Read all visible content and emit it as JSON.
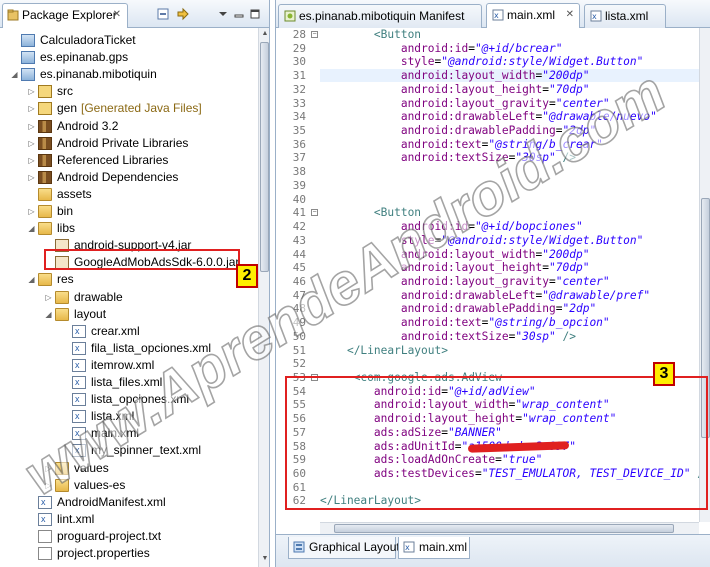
{
  "package_explorer": {
    "tab_label": "Package Explorer",
    "tree": [
      {
        "label": "CalculadoraTicket",
        "icon": "android-project-icon",
        "depth": 0,
        "twisty": ""
      },
      {
        "label": "es.epinanab.gps",
        "icon": "android-project-icon",
        "depth": 0,
        "twisty": ""
      },
      {
        "label": "es.pinanab.mibotiquin",
        "icon": "android-project-icon",
        "depth": 0,
        "twisty": "open"
      },
      {
        "label": "src",
        "icon": "source-folder-icon",
        "depth": 1,
        "twisty": "closed"
      },
      {
        "label": "gen",
        "note": "[Generated Java Files]",
        "icon": "source-folder-icon",
        "depth": 1,
        "twisty": "closed"
      },
      {
        "label": "Android 3.2",
        "icon": "library-icon",
        "depth": 1,
        "twisty": "closed"
      },
      {
        "label": "Android Private Libraries",
        "icon": "library-icon",
        "depth": 1,
        "twisty": "closed"
      },
      {
        "label": "Referenced Libraries",
        "icon": "library-icon",
        "depth": 1,
        "twisty": "closed"
      },
      {
        "label": "Android Dependencies",
        "icon": "library-icon",
        "depth": 1,
        "twisty": "closed"
      },
      {
        "label": "assets",
        "icon": "folder-icon",
        "depth": 1,
        "twisty": ""
      },
      {
        "label": "bin",
        "icon": "folder-icon",
        "depth": 1,
        "twisty": "closed"
      },
      {
        "label": "libs",
        "icon": "folder-icon",
        "depth": 1,
        "twisty": "open"
      },
      {
        "label": "android-support-v4.jar",
        "icon": "jar-icon",
        "depth": 2,
        "twisty": ""
      },
      {
        "label": "GoogleAdMobAdsSdk-6.0.0.jar",
        "icon": "jar-icon",
        "depth": 2,
        "twisty": ""
      },
      {
        "label": "res",
        "icon": "folder-icon",
        "depth": 1,
        "twisty": "open"
      },
      {
        "label": "drawable",
        "icon": "folder-icon",
        "depth": 2,
        "twisty": "closed"
      },
      {
        "label": "layout",
        "icon": "folder-icon",
        "depth": 2,
        "twisty": "open"
      },
      {
        "label": "crear.xml",
        "icon": "xml-file-icon",
        "depth": 3,
        "twisty": ""
      },
      {
        "label": "fila_lista_opciones.xml",
        "icon": "xml-file-icon",
        "depth": 3,
        "twisty": ""
      },
      {
        "label": "itemrow.xml",
        "icon": "xml-file-icon",
        "depth": 3,
        "twisty": ""
      },
      {
        "label": "lista_files.xml",
        "icon": "xml-file-icon",
        "depth": 3,
        "twisty": ""
      },
      {
        "label": "lista_opciones.xml",
        "icon": "xml-file-icon",
        "depth": 3,
        "twisty": ""
      },
      {
        "label": "lista.xml",
        "icon": "xml-file-icon",
        "depth": 3,
        "twisty": ""
      },
      {
        "label": "main.xml",
        "icon": "xml-file-icon",
        "depth": 3,
        "twisty": ""
      },
      {
        "label": "my_spinner_text.xml",
        "icon": "xml-file-icon",
        "depth": 3,
        "twisty": ""
      },
      {
        "label": "values",
        "icon": "folder-icon",
        "depth": 2,
        "twisty": "closed"
      },
      {
        "label": "values-es",
        "icon": "folder-icon",
        "depth": 2,
        "twisty": "closed"
      },
      {
        "label": "AndroidManifest.xml",
        "icon": "xml-file-icon",
        "depth": 1,
        "twisty": ""
      },
      {
        "label": "lint.xml",
        "icon": "xml-file-icon",
        "depth": 1,
        "twisty": ""
      },
      {
        "label": "proguard-project.txt",
        "icon": "text-file-icon",
        "depth": 1,
        "twisty": ""
      },
      {
        "label": "project.properties",
        "icon": "text-file-icon",
        "depth": 1,
        "twisty": ""
      }
    ]
  },
  "editor": {
    "tabs": [
      {
        "label": "es.pinanab.mibotiquin Manifest",
        "active": false
      },
      {
        "label": "main.xml",
        "active": true
      },
      {
        "label": "lista.xml",
        "active": false
      }
    ],
    "lines": [
      {
        "n": "28",
        "parts": [
          [
            "ws",
            "        "
          ],
          [
            "tag",
            "<Button"
          ]
        ]
      },
      {
        "n": "29",
        "parts": [
          [
            "ws",
            "            "
          ],
          [
            "attr",
            "android:id"
          ],
          [
            "p",
            "="
          ],
          [
            "val",
            "\"@+id/bcrear\""
          ]
        ]
      },
      {
        "n": "30",
        "parts": [
          [
            "ws",
            "            "
          ],
          [
            "attr",
            "style"
          ],
          [
            "p",
            "="
          ],
          [
            "val",
            "\"@android:style/Widget.Button\""
          ]
        ]
      },
      {
        "n": "31",
        "parts": [
          [
            "ws",
            "            "
          ],
          [
            "attr",
            "android:layout_width"
          ],
          [
            "p",
            "="
          ],
          [
            "val",
            "\"200dp\""
          ]
        ],
        "current": true
      },
      {
        "n": "32",
        "parts": [
          [
            "ws",
            "            "
          ],
          [
            "attr",
            "android:layout_height"
          ],
          [
            "p",
            "="
          ],
          [
            "val",
            "\"70dp\""
          ]
        ]
      },
      {
        "n": "33",
        "parts": [
          [
            "ws",
            "            "
          ],
          [
            "attr",
            "android:layout_gravity"
          ],
          [
            "p",
            "="
          ],
          [
            "val",
            "\"center\""
          ]
        ]
      },
      {
        "n": "34",
        "parts": [
          [
            "ws",
            "            "
          ],
          [
            "attr",
            "android:drawableLeft"
          ],
          [
            "p",
            "="
          ],
          [
            "val",
            "\"@drawable/nuevo\""
          ]
        ]
      },
      {
        "n": "35",
        "parts": [
          [
            "ws",
            "            "
          ],
          [
            "attr",
            "android:drawablePadding"
          ],
          [
            "p",
            "="
          ],
          [
            "val",
            "\"2dp\""
          ]
        ]
      },
      {
        "n": "36",
        "parts": [
          [
            "ws",
            "            "
          ],
          [
            "attr",
            "android:text"
          ],
          [
            "p",
            "="
          ],
          [
            "val",
            "\"@string/b_crear\""
          ]
        ]
      },
      {
        "n": "37",
        "parts": [
          [
            "ws",
            "            "
          ],
          [
            "attr",
            "android:textSize"
          ],
          [
            "p",
            "="
          ],
          [
            "val",
            "\"30sp\""
          ],
          [
            "tag",
            " />"
          ]
        ]
      },
      {
        "n": "38",
        "parts": []
      },
      {
        "n": "39",
        "parts": []
      },
      {
        "n": "40",
        "parts": []
      },
      {
        "n": "41",
        "parts": [
          [
            "ws",
            "        "
          ],
          [
            "tag",
            "<Button"
          ]
        ]
      },
      {
        "n": "42",
        "parts": [
          [
            "ws",
            "            "
          ],
          [
            "attr",
            "android:id"
          ],
          [
            "p",
            "="
          ],
          [
            "val",
            "\"@+id/bopciones\""
          ]
        ]
      },
      {
        "n": "43",
        "parts": [
          [
            "ws",
            "            "
          ],
          [
            "attr",
            "style"
          ],
          [
            "p",
            "="
          ],
          [
            "val",
            "\"@android:style/Widget.Button\""
          ]
        ]
      },
      {
        "n": "44",
        "parts": [
          [
            "ws",
            "            "
          ],
          [
            "attr",
            "android:layout_width"
          ],
          [
            "p",
            "="
          ],
          [
            "val",
            "\"200dp\""
          ]
        ]
      },
      {
        "n": "45",
        "parts": [
          [
            "ws",
            "            "
          ],
          [
            "attr",
            "android:layout_height"
          ],
          [
            "p",
            "="
          ],
          [
            "val",
            "\"70dp\""
          ]
        ]
      },
      {
        "n": "46",
        "parts": [
          [
            "ws",
            "            "
          ],
          [
            "attr",
            "android:layout_gravity"
          ],
          [
            "p",
            "="
          ],
          [
            "val",
            "\"center\""
          ]
        ]
      },
      {
        "n": "47",
        "parts": [
          [
            "ws",
            "            "
          ],
          [
            "attr",
            "android:drawableLeft"
          ],
          [
            "p",
            "="
          ],
          [
            "val",
            "\"@drawable/pref\""
          ]
        ]
      },
      {
        "n": "48",
        "parts": [
          [
            "ws",
            "            "
          ],
          [
            "attr",
            "android:drawablePadding"
          ],
          [
            "p",
            "="
          ],
          [
            "val",
            "\"2dp\""
          ]
        ]
      },
      {
        "n": "49",
        "parts": [
          [
            "ws",
            "            "
          ],
          [
            "attr",
            "android:text"
          ],
          [
            "p",
            "="
          ],
          [
            "val",
            "\"@string/b_opcion\""
          ]
        ]
      },
      {
        "n": "50",
        "parts": [
          [
            "ws",
            "            "
          ],
          [
            "attr",
            "android:textSize"
          ],
          [
            "p",
            "="
          ],
          [
            "val",
            "\"30sp\""
          ],
          [
            "tag",
            " />"
          ]
        ]
      },
      {
        "n": "51",
        "parts": [
          [
            "ws",
            "    "
          ],
          [
            "tag",
            "</LinearLayout>"
          ]
        ]
      },
      {
        "n": "52",
        "parts": []
      },
      {
        "n": "53",
        "parts": [
          [
            "ws",
            "     "
          ],
          [
            "tag",
            "<com.google.ads.AdView"
          ]
        ]
      },
      {
        "n": "54",
        "parts": [
          [
            "ws",
            "        "
          ],
          [
            "attr",
            "android:id"
          ],
          [
            "p",
            "="
          ],
          [
            "val",
            "\"@+id/adView\""
          ]
        ]
      },
      {
        "n": "55",
        "parts": [
          [
            "ws",
            "        "
          ],
          [
            "attr",
            "android:layout_width"
          ],
          [
            "p",
            "="
          ],
          [
            "val",
            "\"wrap_content\""
          ]
        ]
      },
      {
        "n": "56",
        "parts": [
          [
            "ws",
            "        "
          ],
          [
            "attr",
            "android:layout_height"
          ],
          [
            "p",
            "="
          ],
          [
            "val",
            "\"wrap_content\""
          ]
        ]
      },
      {
        "n": "57",
        "parts": [
          [
            "ws",
            "        "
          ],
          [
            "attr",
            "ads:adSize"
          ],
          [
            "p",
            "="
          ],
          [
            "val",
            "\"BANNER\""
          ]
        ]
      },
      {
        "n": "58",
        "parts": [
          [
            "ws",
            "        "
          ],
          [
            "attr",
            "ads:adUnitId"
          ],
          [
            "p",
            "="
          ],
          [
            "val",
            "\""
          ],
          [
            "redacted",
            "a1500dcdca2c097"
          ],
          [
            "val",
            "\""
          ]
        ]
      },
      {
        "n": "59",
        "parts": [
          [
            "ws",
            "        "
          ],
          [
            "attr",
            "ads:loadAdOnCreate"
          ],
          [
            "p",
            "="
          ],
          [
            "val",
            "\"true\""
          ]
        ]
      },
      {
        "n": "60",
        "parts": [
          [
            "ws",
            "        "
          ],
          [
            "attr",
            "ads:testDevices"
          ],
          [
            "p",
            "="
          ],
          [
            "val",
            "\"TEST_EMULATOR, TEST_DEVICE_ID\""
          ],
          [
            "tag",
            " />"
          ]
        ]
      },
      {
        "n": "61",
        "parts": []
      },
      {
        "n": "62",
        "parts": [
          [
            "tag",
            "</LinearLayout>"
          ]
        ]
      }
    ],
    "bottom_tabs": [
      {
        "label": "Graphical Layout",
        "active": false
      },
      {
        "label": "main.xml",
        "active": true
      }
    ]
  },
  "annotations": {
    "badge_2": "2",
    "badge_3": "3"
  },
  "watermark": "www.AprendeAndroid.com",
  "colors": {
    "xml_tag": "#3f7f7f",
    "xml_attribute": "#7f007f",
    "xml_value": "#2a00ff",
    "annotation_red": "#e02020",
    "badge_yellow": "#ffee00"
  }
}
